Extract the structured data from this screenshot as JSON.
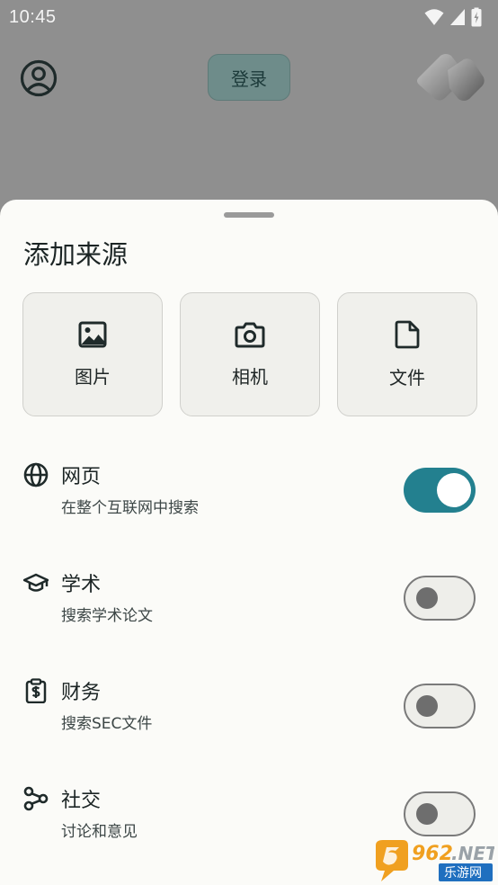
{
  "status": {
    "time": "10:45"
  },
  "header": {
    "login_label": "登录"
  },
  "sheet": {
    "title": "添加来源",
    "cards": [
      {
        "label": "图片",
        "icon": "image-icon"
      },
      {
        "label": "相机",
        "icon": "camera-icon"
      },
      {
        "label": "文件",
        "icon": "file-icon"
      }
    ],
    "options": [
      {
        "title": "网页",
        "desc": "在整个互联网中搜索",
        "icon": "globe-icon",
        "enabled": true
      },
      {
        "title": "学术",
        "desc": "搜索学术论文",
        "icon": "graduation-cap-icon",
        "enabled": false
      },
      {
        "title": "财务",
        "desc": "搜索SEC文件",
        "icon": "finance-clipboard-icon",
        "enabled": false
      },
      {
        "title": "社交",
        "desc": "讨论和意见",
        "icon": "social-network-icon",
        "enabled": false
      }
    ]
  },
  "watermark": {
    "text": "962.NET",
    "subtext": "乐游网"
  },
  "colors": {
    "accent": "#23808f",
    "sheet_bg": "#fbfbf8",
    "scrim": "#8f8f8f"
  }
}
